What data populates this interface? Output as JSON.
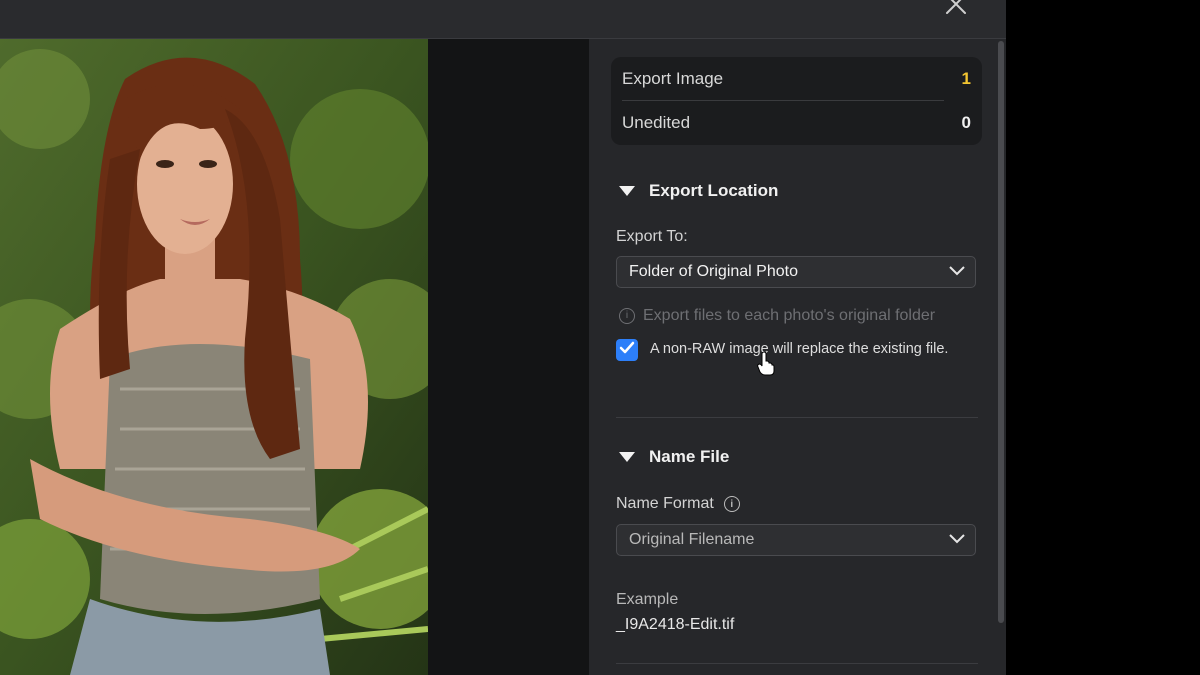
{
  "summary": {
    "export_image_label": "Export Image",
    "export_image_count": "1",
    "unedited_label": "Unedited",
    "unedited_count": "0"
  },
  "export_location": {
    "title": "Export Location",
    "export_to_label": "Export To:",
    "export_to_value": "Folder of Original Photo",
    "info_text": "Export files to each photo's original folder",
    "checkbox_checked": true,
    "checkbox_label": "A non-RAW image will replace the existing file."
  },
  "name_file": {
    "title": "Name File",
    "name_format_label": "Name Format",
    "name_format_value": "Original Filename",
    "example_label": "Example",
    "example_value": "_I9A2418-Edit.tif"
  },
  "icons": {
    "close": "close-icon",
    "collapse": "triangle-down-icon",
    "dropdown": "chevron-down-icon",
    "info": "info-icon",
    "check": "checkmark-icon",
    "cursor": "hand-pointer-icon"
  },
  "colors": {
    "accent": "#2d7ff9",
    "count_highlight": "#f3c531",
    "panel_bg": "#26272a"
  }
}
